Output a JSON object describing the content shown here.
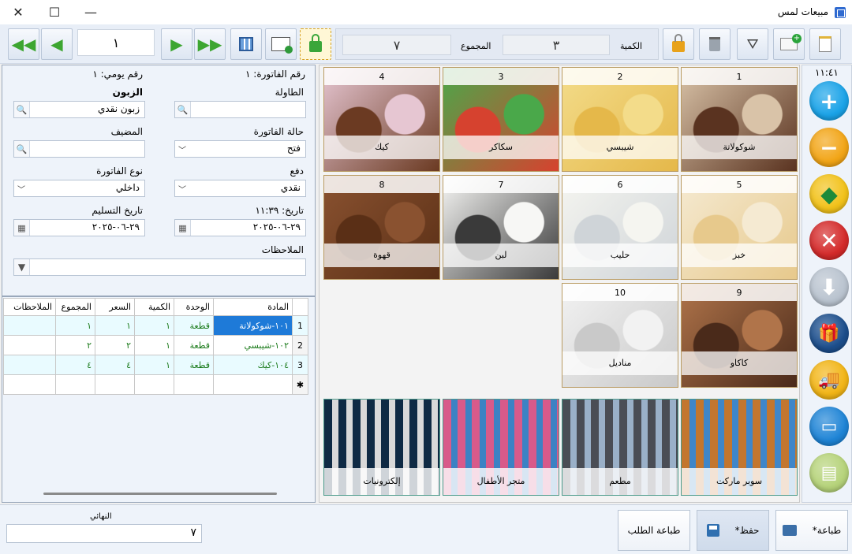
{
  "window": {
    "title": "مبيعات لمس",
    "controls": {
      "close": "✕",
      "maximize": "☐",
      "minimize": "—"
    }
  },
  "toolbar": {
    "record_number": "١",
    "quantity_label": "الكمية",
    "quantity_value": "٣",
    "total_label": "المجموع",
    "total_value": "٧"
  },
  "form": {
    "invoice_number": "رقم الفاتورة: ١",
    "daily_number": "رقم يومي: ١",
    "table_label": "الطاولة",
    "table_value": "",
    "customer_label": "الزبون",
    "customer_value": "زبون نقدي",
    "status_label": "حالة الفاتورة",
    "status_value": "فتح",
    "host_label": "المضيف",
    "host_value": "",
    "payment_label": "دفع",
    "payment_value": "نقدي",
    "invoice_type_label": "نوع الفاتورة",
    "invoice_type_value": "داخلي",
    "date_label": "تاريخ: ١١:٣٩",
    "date_value": "٢٩-٠٦-٢٠٢٥",
    "delivery_label": "تاريخ التسليم",
    "delivery_value": "٢٩-٠٦-٢٠٢٥",
    "notes_label": "الملاحظات",
    "notes_value": ""
  },
  "grid": {
    "columns": [
      "المادة",
      "الوحدة",
      "الكمية",
      "السعر",
      "المجموع",
      "الملاحظات"
    ],
    "rows": [
      {
        "n": "1",
        "item": "١٠١-شوكولاتة",
        "unit": "قطعة",
        "qty": "١",
        "price": "١",
        "total": "١",
        "notes": ""
      },
      {
        "n": "2",
        "item": "١٠٢-شيبسي",
        "unit": "قطعة",
        "qty": "١",
        "price": "٢",
        "total": "٢",
        "notes": ""
      },
      {
        "n": "3",
        "item": "١٠٤-كيك",
        "unit": "قطعة",
        "qty": "١",
        "price": "٤",
        "total": "٤",
        "notes": ""
      }
    ],
    "new_row_marker": "✱"
  },
  "products": [
    {
      "num": "1",
      "name": "شوكولاتة",
      "color1": "#5a3320",
      "color2": "#d9c3a8"
    },
    {
      "num": "2",
      "name": "شيبسي",
      "color1": "#e5b84a",
      "color2": "#f3dc8a"
    },
    {
      "num": "3",
      "name": "سكاكر",
      "color1": "#d6422f",
      "color2": "#4aa84a"
    },
    {
      "num": "4",
      "name": "كيك",
      "color1": "#6b3a22",
      "color2": "#e6c6d2"
    },
    {
      "num": "5",
      "name": "خبز",
      "color1": "#e7c98c",
      "color2": "#f5ead2"
    },
    {
      "num": "6",
      "name": "حليب",
      "color1": "#cfd4d8",
      "color2": "#f5f5f0"
    },
    {
      "num": "7",
      "name": "لبن",
      "color1": "#3a3a3a",
      "color2": "#f7f7f5"
    },
    {
      "num": "8",
      "name": "قهوة",
      "color1": "#5a2f16",
      "color2": "#8a5230"
    },
    {
      "num": "9",
      "name": "كاكاو",
      "color1": "#4a2a1a",
      "color2": "#b0744a"
    },
    {
      "num": "10",
      "name": "مناديل",
      "color1": "#c9c9c9",
      "color2": "#f2f2f2"
    }
  ],
  "categories": [
    {
      "name": "سوبر ماركت",
      "color1": "#c3762e",
      "color2": "#3f86c9"
    },
    {
      "name": "مطعم",
      "color1": "#4a4d55",
      "color2": "#9ab0c8"
    },
    {
      "name": "متجر الأطفال",
      "color1": "#d85a8a",
      "color2": "#3c82c4"
    },
    {
      "name": "إلكترونيات",
      "color1": "#0f2a44",
      "color2": "#d9d9d9"
    }
  ],
  "sidebar": {
    "clock": "١١:٤١",
    "buttons": [
      {
        "icon": "plus-icon",
        "color": "#1aa3e8",
        "glyph": "+"
      },
      {
        "icon": "minus-icon",
        "color": "#f2a516",
        "glyph": "−"
      },
      {
        "icon": "diamond-icon",
        "color": "#f2c21a",
        "glyph": "◆"
      },
      {
        "icon": "delete-icon",
        "color": "#d42a2a",
        "glyph": "✕"
      },
      {
        "icon": "arrow-down-icon",
        "color": "#b9c3cf",
        "glyph": "⬇"
      },
      {
        "icon": "gift-icon",
        "color": "#1c4e8c",
        "glyph": "🎁"
      },
      {
        "icon": "delivery-truck-icon",
        "color": "#f2b516",
        "glyph": "🚚"
      },
      {
        "icon": "documents-icon",
        "color": "#1e84d6",
        "glyph": "▭"
      },
      {
        "icon": "cash-register-icon",
        "color": "#b6d37a",
        "glyph": "▤"
      }
    ]
  },
  "bottom": {
    "final_label": "النهائي",
    "final_value": "٧",
    "print_order": "طباعة الطلب",
    "save": "حفظ*",
    "print": "طباعة*"
  }
}
